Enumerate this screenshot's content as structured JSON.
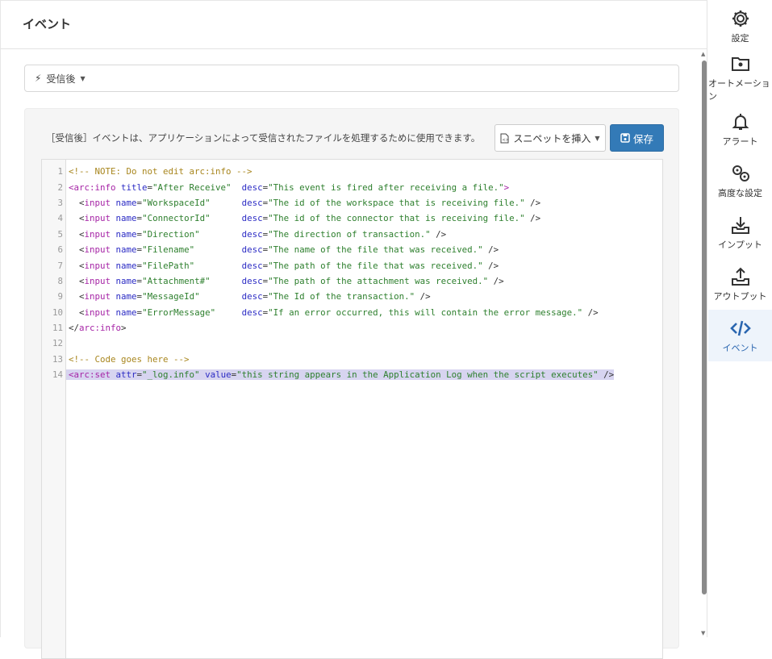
{
  "header": {
    "title": "イベント"
  },
  "event_select": {
    "icon": "bolt-icon",
    "value": "受信後"
  },
  "panel": {
    "description": "［受信後］イベントは、アプリケーションによって受信されたファイルを処理するために使用できます。",
    "snippet_label": "スニペットを挿入",
    "save_label": "保存"
  },
  "editor": {
    "lines": [
      [
        [
          "com",
          "<!-- NOTE: Do not edit arc:info -->"
        ]
      ],
      [
        [
          "tag",
          "<arc:info "
        ],
        [
          "attr",
          "title"
        ],
        [
          "p",
          "="
        ],
        [
          "str",
          "\"After Receive\""
        ],
        [
          "p",
          "  "
        ],
        [
          "attr",
          "desc"
        ],
        [
          "p",
          "="
        ],
        [
          "str",
          "\"This event is fired after receiving a file.\""
        ],
        [
          "tag",
          ">"
        ]
      ],
      [
        [
          "p",
          "  <"
        ],
        [
          "tag",
          "input "
        ],
        [
          "attr",
          "name"
        ],
        [
          "p",
          "="
        ],
        [
          "str",
          "\"WorkspaceId\""
        ],
        [
          "p",
          "      "
        ],
        [
          "attr",
          "desc"
        ],
        [
          "p",
          "="
        ],
        [
          "str",
          "\"The id of the workspace that is receiving file.\""
        ],
        [
          "p",
          " />"
        ]
      ],
      [
        [
          "p",
          "  <"
        ],
        [
          "tag",
          "input "
        ],
        [
          "attr",
          "name"
        ],
        [
          "p",
          "="
        ],
        [
          "str",
          "\"ConnectorId\""
        ],
        [
          "p",
          "      "
        ],
        [
          "attr",
          "desc"
        ],
        [
          "p",
          "="
        ],
        [
          "str",
          "\"The id of the connector that is receiving file.\""
        ],
        [
          "p",
          " />"
        ]
      ],
      [
        [
          "p",
          "  <"
        ],
        [
          "tag",
          "input "
        ],
        [
          "attr",
          "name"
        ],
        [
          "p",
          "="
        ],
        [
          "str",
          "\"Direction\""
        ],
        [
          "p",
          "        "
        ],
        [
          "attr",
          "desc"
        ],
        [
          "p",
          "="
        ],
        [
          "str",
          "\"The direction of transaction.\""
        ],
        [
          "p",
          " />"
        ]
      ],
      [
        [
          "p",
          "  <"
        ],
        [
          "tag",
          "input "
        ],
        [
          "attr",
          "name"
        ],
        [
          "p",
          "="
        ],
        [
          "str",
          "\"Filename\""
        ],
        [
          "p",
          "         "
        ],
        [
          "attr",
          "desc"
        ],
        [
          "p",
          "="
        ],
        [
          "str",
          "\"The name of the file that was received.\""
        ],
        [
          "p",
          " />"
        ]
      ],
      [
        [
          "p",
          "  <"
        ],
        [
          "tag",
          "input "
        ],
        [
          "attr",
          "name"
        ],
        [
          "p",
          "="
        ],
        [
          "str",
          "\"FilePath\""
        ],
        [
          "p",
          "         "
        ],
        [
          "attr",
          "desc"
        ],
        [
          "p",
          "="
        ],
        [
          "str",
          "\"The path of the file that was received.\""
        ],
        [
          "p",
          " />"
        ]
      ],
      [
        [
          "p",
          "  <"
        ],
        [
          "tag",
          "input "
        ],
        [
          "attr",
          "name"
        ],
        [
          "p",
          "="
        ],
        [
          "str",
          "\"Attachment#\""
        ],
        [
          "p",
          "      "
        ],
        [
          "attr",
          "desc"
        ],
        [
          "p",
          "="
        ],
        [
          "str",
          "\"The path of the attachment was received.\""
        ],
        [
          "p",
          " />"
        ]
      ],
      [
        [
          "p",
          "  <"
        ],
        [
          "tag",
          "input "
        ],
        [
          "attr",
          "name"
        ],
        [
          "p",
          "="
        ],
        [
          "str",
          "\"MessageId\""
        ],
        [
          "p",
          "        "
        ],
        [
          "attr",
          "desc"
        ],
        [
          "p",
          "="
        ],
        [
          "str",
          "\"The Id of the transaction.\""
        ],
        [
          "p",
          " />"
        ]
      ],
      [
        [
          "p",
          "  <"
        ],
        [
          "tag",
          "input "
        ],
        [
          "attr",
          "name"
        ],
        [
          "p",
          "="
        ],
        [
          "str",
          "\"ErrorMessage\""
        ],
        [
          "p",
          "     "
        ],
        [
          "attr",
          "desc"
        ],
        [
          "p",
          "="
        ],
        [
          "str",
          "\"If an error occurred, this will contain the error message.\""
        ],
        [
          "p",
          " />"
        ]
      ],
      [
        [
          "p",
          "</"
        ],
        [
          "tag",
          "arc:info"
        ],
        [
          "p",
          ">"
        ]
      ],
      [],
      [
        [
          "com",
          "<!-- Code goes here -->"
        ]
      ],
      [
        [
          "tag",
          "<arc:set "
        ],
        [
          "attr",
          "attr"
        ],
        [
          "p",
          "="
        ],
        [
          "str",
          "\"_log.info\""
        ],
        [
          "p",
          " "
        ],
        [
          "attr",
          "value"
        ],
        [
          "p",
          "="
        ],
        [
          "str",
          "\"this string appears in the Application Log when the script executes\""
        ],
        [
          "p",
          " />"
        ]
      ]
    ],
    "selected_line": 14
  },
  "sidebar": {
    "items": [
      {
        "label": "設定",
        "icon": "gear-icon"
      },
      {
        "label": "オートメーション",
        "icon": "folder-gear-icon"
      },
      {
        "label": "アラート",
        "icon": "bell-icon"
      },
      {
        "label": "高度な設定",
        "icon": "gears-icon"
      },
      {
        "label": "インプット",
        "icon": "download-tray-icon"
      },
      {
        "label": "アウトプット",
        "icon": "upload-tray-icon"
      },
      {
        "label": "イベント",
        "icon": "code-icon",
        "active": true
      }
    ]
  }
}
